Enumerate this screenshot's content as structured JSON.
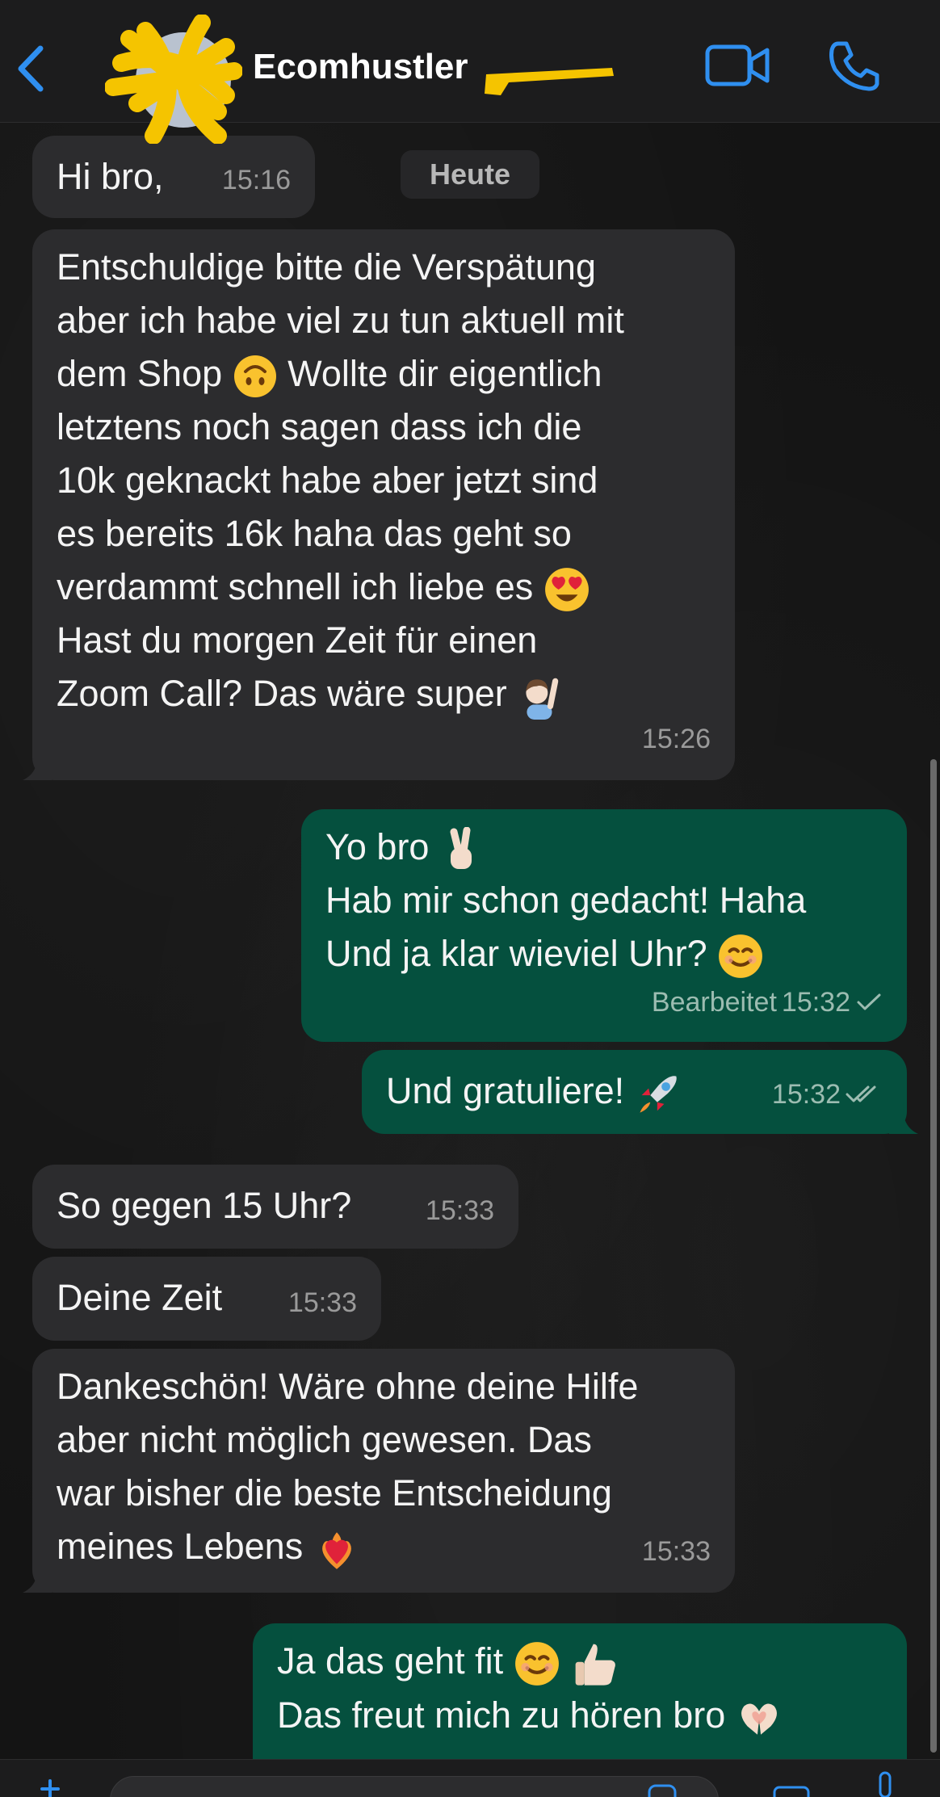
{
  "header": {
    "contact_name": "Ecomhustler",
    "icons": [
      "back-chevron-icon",
      "avatar",
      "video-call-icon",
      "phone-call-icon"
    ],
    "accent_color": "#2f8ff0"
  },
  "date_separator": "Heute",
  "messages": [
    {
      "direction": "in",
      "text": "Hi bro,",
      "time": "15:16"
    },
    {
      "direction": "in",
      "text_lines": [
        "Entschuldige bitte die Verspätung",
        "aber ich habe viel zu tun aktuell mit",
        "dem Shop",
        "Wollte dir eigentlich",
        "letztens noch sagen dass ich die",
        "10k geknackt habe aber jetzt sind",
        "es bereits 16k haha das geht so",
        "verdammt schnell ich liebe es",
        "Hast du morgen Zeit für einen",
        "Zoom Call? Das wäre super"
      ],
      "time": "15:26"
    },
    {
      "direction": "out",
      "text_lines": [
        "Yo bro",
        "Hab mir schon gedacht! Haha",
        "Und ja klar wieviel Uhr?"
      ],
      "edited_label": "Bearbeitet",
      "time": "15:32",
      "status": "sent"
    },
    {
      "direction": "out",
      "text": "Und gratuliere!",
      "time": "15:32",
      "status": "read"
    },
    {
      "direction": "in",
      "text": "So gegen 15 Uhr?",
      "time": "15:33"
    },
    {
      "direction": "in",
      "text": "Deine Zeit",
      "time": "15:33"
    },
    {
      "direction": "in",
      "text_lines": [
        "Dankeschön! Wäre ohne deine Hilfe",
        "aber nicht möglich gewesen. Das",
        "war bisher die beste Entscheidung",
        "meines Lebens"
      ],
      "time": "15:33"
    },
    {
      "direction": "out",
      "text_lines": [
        "Ja das geht fit",
        "Das freut mich zu hören bro"
      ]
    }
  ],
  "colors": {
    "incoming_bubble": "#2c2c2e",
    "outgoing_bubble": "#05503e",
    "background": "#141414",
    "scribble_yellow": "#f5c400"
  }
}
